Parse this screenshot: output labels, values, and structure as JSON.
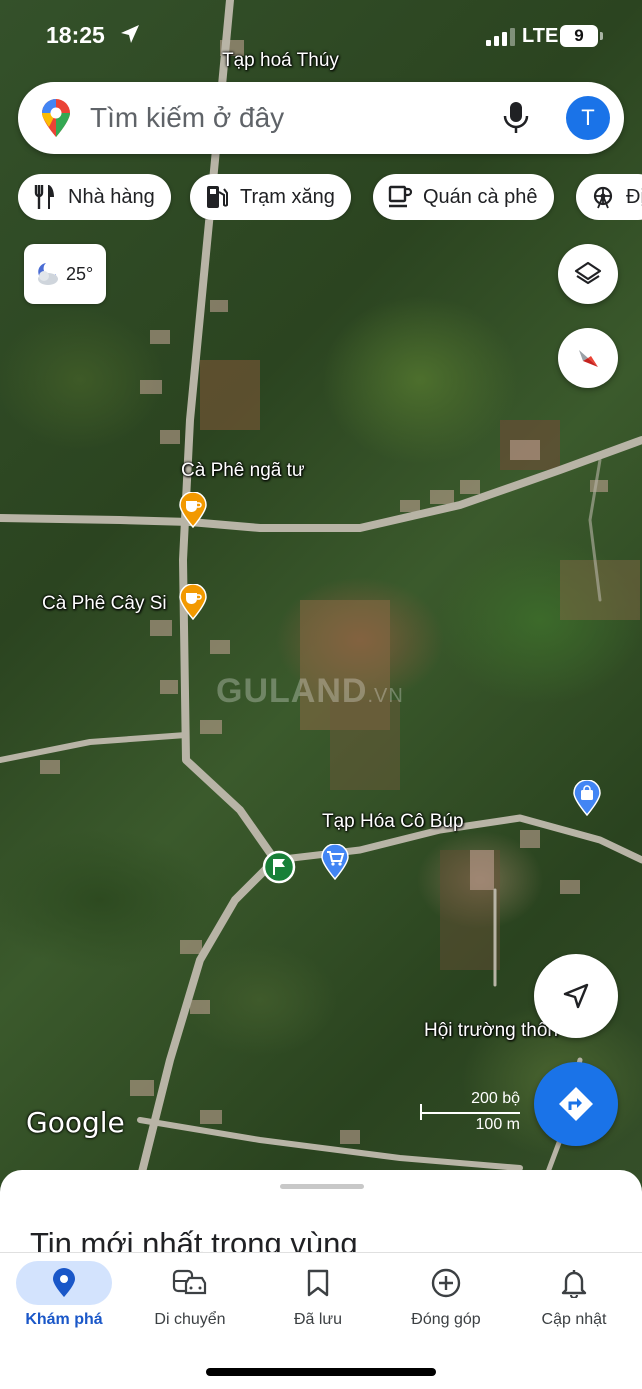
{
  "status_bar": {
    "time": "18:25",
    "network": "LTE",
    "battery": "9"
  },
  "search": {
    "placeholder": "Tìm kiếm ở đây",
    "avatar_initial": "T"
  },
  "chips": [
    {
      "label": "Nhà hàng",
      "icon": "fork-knife-icon"
    },
    {
      "label": "Trạm xăng",
      "icon": "gas-pump-icon"
    },
    {
      "label": "Quán cà phê",
      "icon": "coffee-cup-icon"
    },
    {
      "label": "Đị",
      "icon": "ferris-wheel-icon"
    }
  ],
  "weather": {
    "temp": "25°",
    "icon": "partly-cloudy-night-icon"
  },
  "map": {
    "labels": {
      "tap_hoa_thuy": "Tạp hoá Thúy",
      "ca_phe_nga_tu": "Cà Phê ngã tư",
      "ca_phe_cay_si": "Cà Phê Cây Si",
      "tap_hoa_co_bup": "Tạp Hóa Cô Búp",
      "hoi_truong": "Hội trường thôn"
    },
    "watermark": {
      "main": "GULAND",
      "suffix": ".VN"
    },
    "google": "Google",
    "scale": {
      "top": "200 bộ",
      "bottom": "100 m"
    },
    "colors": {
      "cafe_pin": "#f29900",
      "shop_pin": "#4285f4",
      "flag_pin": "#188038"
    }
  },
  "sheet": {
    "title": "Tin mới nhất trong vùng"
  },
  "nav": [
    {
      "label": "Khám phá",
      "icon": "location-pin-icon",
      "active": true
    },
    {
      "label": "Di chuyển",
      "icon": "commute-icon",
      "active": false
    },
    {
      "label": "Đã lưu",
      "icon": "bookmark-icon",
      "active": false
    },
    {
      "label": "Đóng góp",
      "icon": "add-circle-icon",
      "active": false
    },
    {
      "label": "Cập nhật",
      "icon": "bell-icon",
      "active": false
    }
  ],
  "accent_color": "#1a73e8"
}
